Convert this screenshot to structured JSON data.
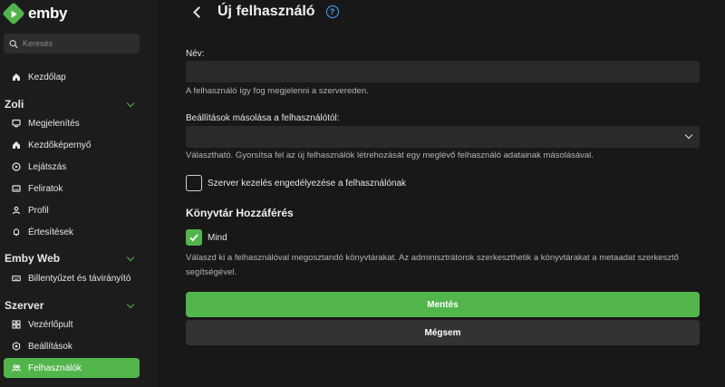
{
  "app": {
    "logo_text": "emby"
  },
  "search": {
    "placeholder": "Keresés"
  },
  "nav": {
    "home": {
      "label": "Kezdőlap",
      "icon": "home-icon"
    },
    "user_section": {
      "title": "Zoli",
      "items": [
        {
          "label": "Megjelenítés",
          "icon": "monitor-icon"
        },
        {
          "label": "Kezdőképernyő",
          "icon": "home-icon"
        },
        {
          "label": "Lejátszás",
          "icon": "play-circle-icon"
        },
        {
          "label": "Feliratok",
          "icon": "subtitles-icon"
        },
        {
          "label": "Profil",
          "icon": "person-icon"
        },
        {
          "label": "Értesítések",
          "icon": "bell-icon"
        }
      ]
    },
    "emby_web_section": {
      "title": "Emby Web",
      "items": [
        {
          "label": "Billentyűzet és távirányító",
          "icon": "keyboard-icon"
        }
      ]
    },
    "server_section": {
      "title": "Szerver",
      "items": [
        {
          "label": "Vezérlőpult",
          "icon": "dashboard-icon"
        },
        {
          "label": "Beállítások",
          "icon": "gear-icon"
        },
        {
          "label": "Felhasználók",
          "icon": "people-icon",
          "active": true
        }
      ]
    }
  },
  "page": {
    "title": "Új felhasználó",
    "name_field": {
      "label": "Név:",
      "value": "",
      "help": "A felhasználó így fog megjelenni a szervereden."
    },
    "copy_settings": {
      "label": "Beállítások másolása a felhasználótól:",
      "selected": "",
      "help": "Választható. Gyorsítsa fel az új felhasználók létrehozását egy meglévő felhasználó adatainak másolásával."
    },
    "server_manage": {
      "label": "Szerver kezelés engedélyezése a felhasználónak",
      "checked": false
    },
    "library_access": {
      "heading": "Könyvtár Hozzáférés",
      "all_label": "Mind",
      "all_checked": true,
      "help": "Válaszd ki a felhasználóval megosztandó könyvtárakat. Az adminisztrátorok szerkeszthetik a könyvtárakat a metaadat szerkesztő segítségével."
    },
    "buttons": {
      "save": "Mentés",
      "cancel": "Mégsem"
    }
  },
  "colors": {
    "accent": "#52b54b",
    "help_icon": "#4aa3ff",
    "background": "#181818",
    "sidebar": "#1c1c1c"
  }
}
